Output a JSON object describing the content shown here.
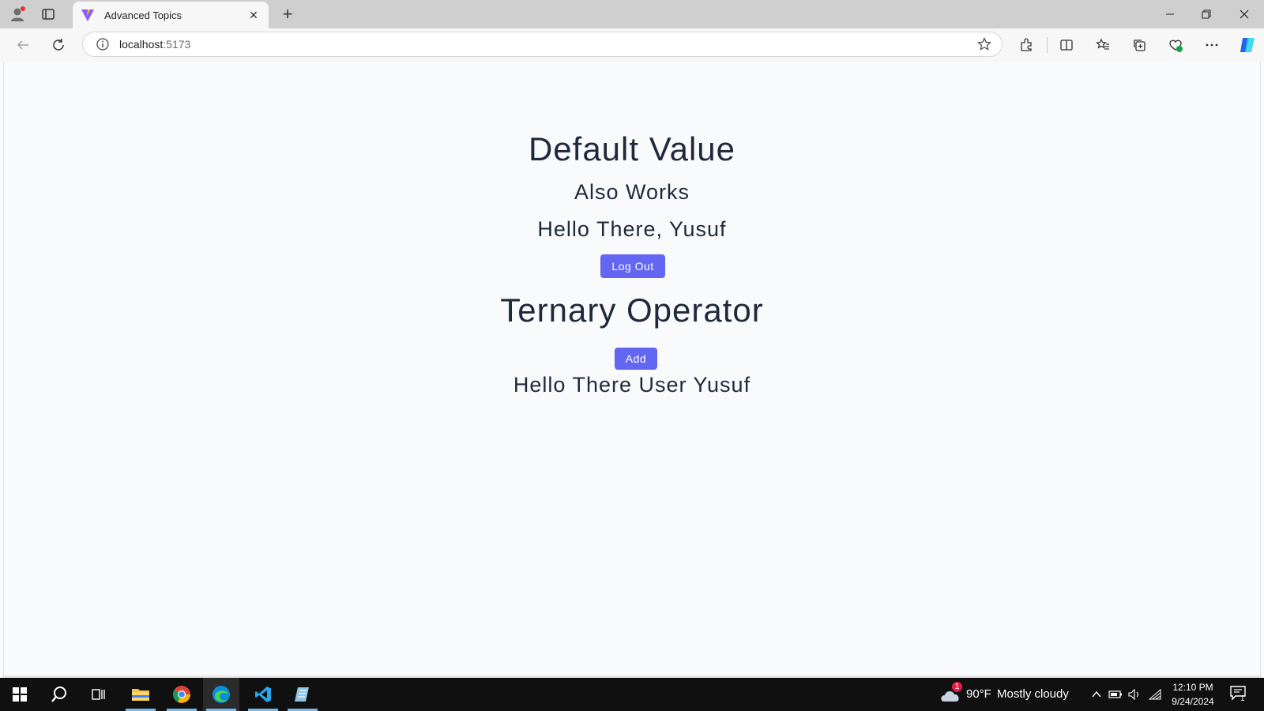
{
  "browser": {
    "tab_title": "Advanced Topics",
    "url_host": "localhost",
    "url_port": ":5173"
  },
  "page": {
    "heading_default": "Default Value",
    "text_also_works": "Also Works",
    "text_hello": "Hello There, Yusuf",
    "logout_label": "Log Out",
    "heading_ternary": "Ternary Operator",
    "add_label": "Add",
    "text_user": "Hello There User Yusuf"
  },
  "taskbar": {
    "weather_badge": "1",
    "weather_temp": "90°F",
    "weather_desc": "Mostly cloudy",
    "time": "12:10 PM",
    "date": "9/24/2024",
    "notification_count": "1"
  },
  "colors": {
    "accent": "#6366f1",
    "text": "#1e293b",
    "page_bg": "#f9fafb",
    "taskbar_bg": "#101010"
  }
}
